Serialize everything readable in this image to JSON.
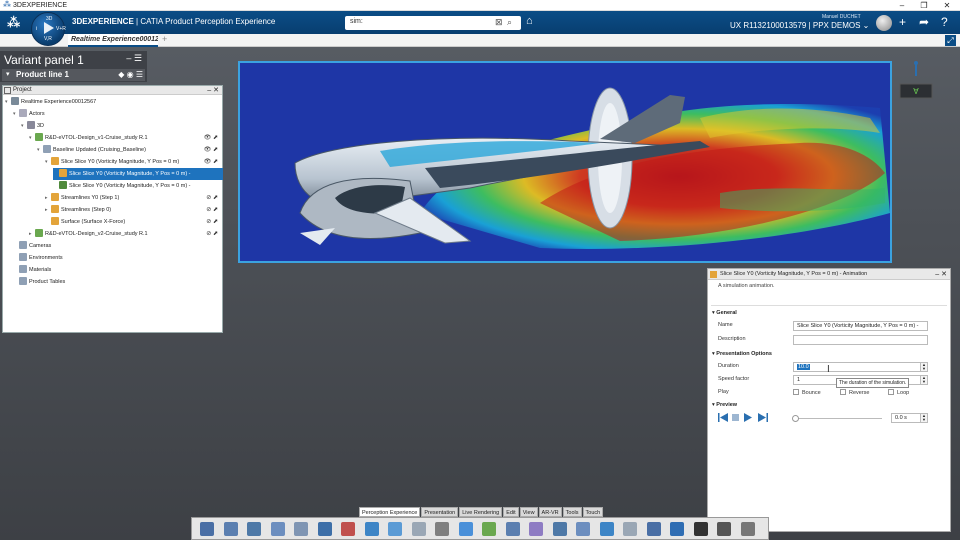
{
  "window": {
    "title": "3DEXPERIENCE"
  },
  "appbar": {
    "brand_bold": "3DEXPERIENCE",
    "brand_rest": " | CATIA Product Perception Experience",
    "compass_label": "V,R",
    "search_value": "sim:",
    "user_name": "Manuel DUCHET",
    "workspace": "UX R1132100013579 | PPX DEMOS",
    "compass_quadrants": {
      "north": "3D",
      "west": "i",
      "east": "V+R",
      "south": "V,R"
    }
  },
  "tabs": {
    "active": "Realtime Experience00012",
    "add": "+"
  },
  "variant_panel": {
    "title": "Variant panel 1",
    "product_line": "Product line 1"
  },
  "project": {
    "title": "Project",
    "tree": [
      {
        "label": "Realtime Experience00012567",
        "level": 0,
        "exp": "▾",
        "icon": "#7a8a99"
      },
      {
        "label": "Actors",
        "level": 1,
        "exp": "▾",
        "icon": "#aab"
      },
      {
        "label": "3D",
        "level": 2,
        "exp": "▾",
        "icon": "#889"
      },
      {
        "label": "R&D-eVTOL-Design_v1-Cruise_study R.1",
        "level": 3,
        "exp": "▾",
        "icon": "#6aa84f",
        "icons": "👁 ⬈"
      },
      {
        "label": "Baseline Updated (Cruising_Baseline)",
        "level": 4,
        "exp": "▾",
        "icon": "#8fa0b5",
        "icons": "👁 ⬈"
      },
      {
        "label": "Slice Slice Y0 (Vorticity Magnitude, Y Pos = 0 m)",
        "level": 5,
        "exp": "▾",
        "icon": "#e3a43a",
        "icons": "👁 ⬈"
      },
      {
        "label": "Slice Slice Y0 (Vorticity Magnitude, Y Pos = 0 m) -",
        "level": 6,
        "exp": "",
        "icon": "#e3a43a",
        "selected": true
      },
      {
        "label": "Slice Slice Y0 (Vorticity Magnitude, Y Pos = 0 m) -",
        "level": 6,
        "exp": "",
        "icon": "#4f8a3c"
      },
      {
        "label": "Streamlines Y0 (Step 1)",
        "level": 5,
        "exp": "▸",
        "icon": "#e3a43a",
        "icons": "⊘ ⬈"
      },
      {
        "label": "Streamlines (Step 0)",
        "level": 5,
        "exp": "▸",
        "icon": "#e3a43a",
        "icons": "⊘ ⬈"
      },
      {
        "label": "Surface (Surface X-Force)",
        "level": 5,
        "exp": "",
        "icon": "#e3a43a",
        "icons": "⊘ ⬈"
      },
      {
        "label": "R&D-eVTOL-Design_v2-Cruise_study R.1",
        "level": 3,
        "exp": "▸",
        "icon": "#6aa84f",
        "icons": "⊘ ⬈"
      },
      {
        "label": "Cameras",
        "level": 1,
        "exp": "",
        "icon": "#8fa0b5"
      },
      {
        "label": "Environments",
        "level": 1,
        "exp": "",
        "icon": "#8fa0b5"
      },
      {
        "label": "Materials",
        "level": 1,
        "exp": "",
        "icon": "#8fa0b5"
      },
      {
        "label": "Product Tables",
        "level": 1,
        "exp": "",
        "icon": "#8fa0b5"
      }
    ]
  },
  "animation_panel": {
    "title": "Slice Slice Y0 (Vorticity Magnitude, Y Pos = 0 m) - Animation",
    "description": "A simulation animation.",
    "general_header": "General",
    "name_label": "Name",
    "name_value": "Slice Slice Y0 (Vorticity Magnitude, Y Pos = 0 m) -",
    "description_label": "Description",
    "description_value": "",
    "presentation_header": "Presentation Options",
    "duration_label": "Duration",
    "duration_value": "10.0",
    "speed_label": "Speed factor",
    "speed_value": "1",
    "play_label": "Play",
    "bounce_label": "Bounce",
    "reverse_label": "Reverse",
    "loop_label": "Loop",
    "preview_header": "Preview",
    "preview_time": "0.0 s",
    "tooltip": "The duration of the simulation."
  },
  "bottom_tabs": [
    "Perception Experience",
    "Presentation",
    "Live Rendering",
    "Edit",
    "View",
    "AR-VR",
    "Tools",
    "Touch"
  ],
  "toolbar_icon_colors": [
    "#4a6fa5",
    "#5b7fb0",
    "#4e79a7",
    "#6c8ebf",
    "#7f95b3",
    "#3d6fa8",
    "#c0504d",
    "#3d85c6",
    "#5b9bd5",
    "#9aa7b5",
    "#7f7f7f",
    "#4a90d9",
    "#6aa84f",
    "#5b7fb0",
    "#8e7cc3",
    "#4e79a7",
    "#6c8ebf",
    "#3d85c6",
    "#9aa7b5",
    "#4a6fa5",
    "#2f6db3",
    "#333333",
    "#555555",
    "#777777"
  ]
}
